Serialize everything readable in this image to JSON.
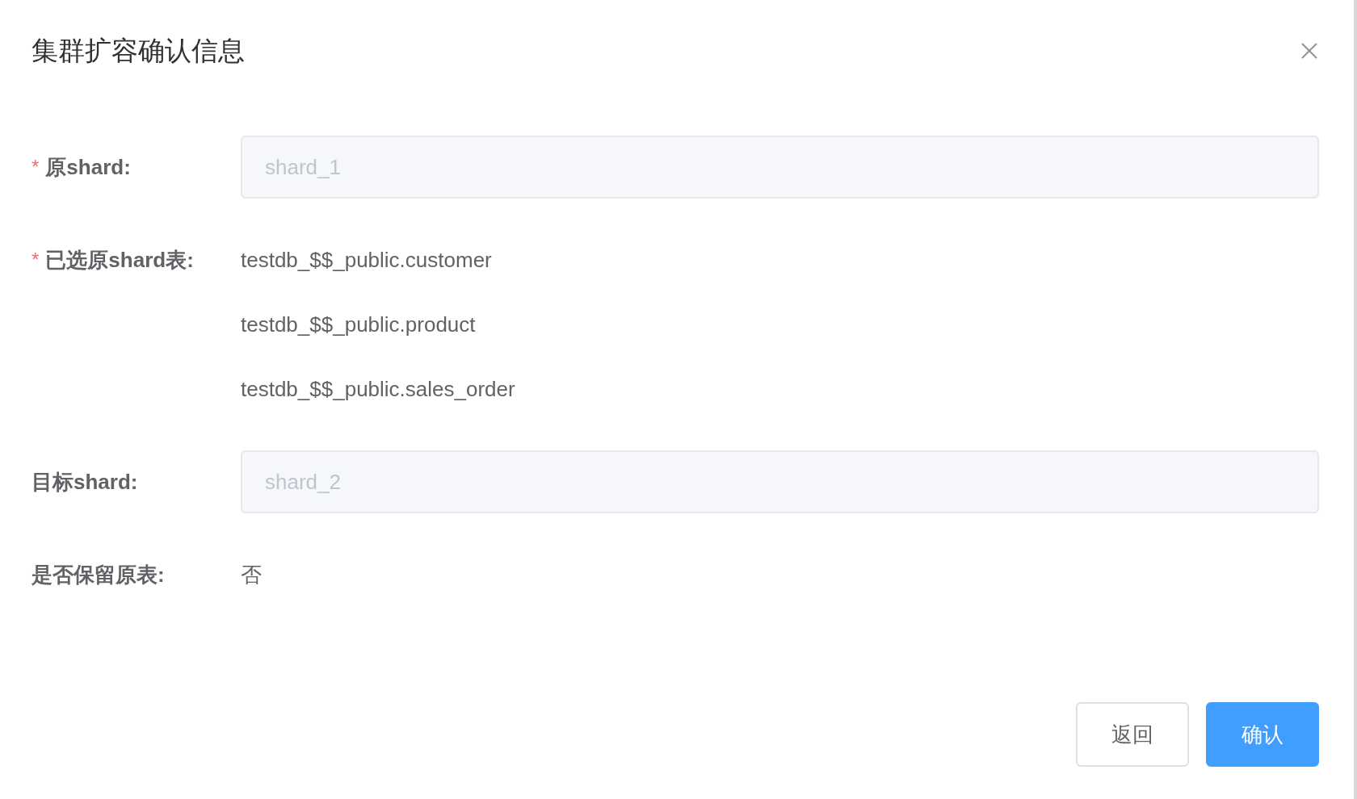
{
  "dialog": {
    "title": "集群扩容确认信息"
  },
  "fields": [
    {
      "kind": "input",
      "required_mark": "*",
      "label": "原shard:",
      "value": "shard_1",
      "disabled": true
    },
    {
      "kind": "list",
      "required_mark": "*",
      "label": "已选原shard表:",
      "values": [
        "testdb_$$_public.customer",
        "testdb_$$_public.product",
        "testdb_$$_public.sales_order"
      ]
    },
    {
      "kind": "input",
      "label": "目标shard:",
      "value": "shard_2",
      "disabled": true
    },
    {
      "kind": "text",
      "label": "是否保留原表:",
      "value": "否"
    }
  ],
  "buttons": [
    {
      "kind": "default",
      "label": "返回"
    },
    {
      "kind": "primary",
      "label": "确认"
    }
  ]
}
